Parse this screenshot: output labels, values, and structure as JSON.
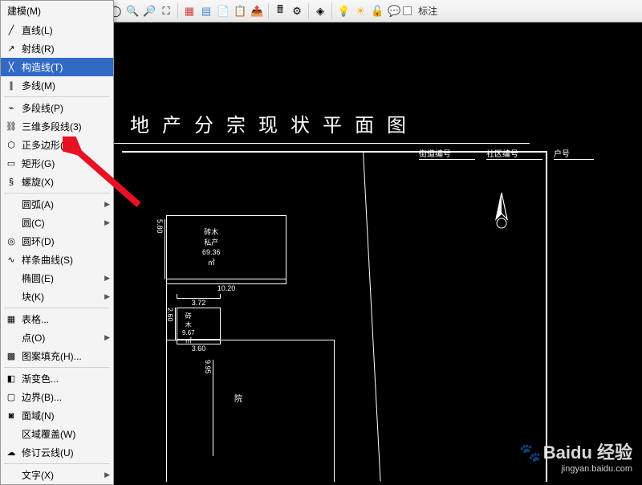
{
  "toolbar": {
    "annotation_label": "标注",
    "icons": [
      "pencil-icon",
      "brush-icon",
      "undo-icon",
      "redo-icon",
      "sep",
      "select-icon",
      "lasso-icon",
      "zoom-in-icon",
      "zoom-out-icon",
      "zoom-extent-icon",
      "sep",
      "grid-icon",
      "table-icon",
      "sheet-icon",
      "props-icon",
      "export-icon",
      "calc-icon",
      "settings-icon",
      "sep",
      "layers-icon",
      "sep",
      "bulb-icon",
      "sun-icon",
      "lock-icon",
      "chat-icon"
    ]
  },
  "menu": {
    "title": "建模(M)",
    "groups": [
      [
        {
          "icon": "line-icon",
          "label": "直线(L)",
          "arrow": false
        },
        {
          "icon": "ray-icon",
          "label": "射线(R)",
          "arrow": false
        },
        {
          "icon": "xline-icon",
          "label": "构造线(T)",
          "arrow": false,
          "selected": true
        },
        {
          "icon": "mline-icon",
          "label": "多线(M)",
          "arrow": false
        }
      ],
      [
        {
          "icon": "pline-icon",
          "label": "多段线(P)",
          "arrow": false
        },
        {
          "icon": "3dpoly-icon",
          "label": "三维多段线(3)",
          "arrow": false
        },
        {
          "icon": "polygon-icon",
          "label": "正多边形(Y)",
          "arrow": false
        },
        {
          "icon": "rect-icon",
          "label": "矩形(G)",
          "arrow": false
        },
        {
          "icon": "helix-icon",
          "label": "螺旋(X)",
          "arrow": false
        }
      ],
      [
        {
          "icon": "",
          "label": "圆弧(A)",
          "arrow": true
        },
        {
          "icon": "",
          "label": "圆(C)",
          "arrow": true
        },
        {
          "icon": "donut-icon",
          "label": "圆环(D)",
          "arrow": false
        },
        {
          "icon": "spline-icon",
          "label": "样条曲线(S)",
          "arrow": false
        },
        {
          "icon": "",
          "label": "椭圆(E)",
          "arrow": true
        },
        {
          "icon": "",
          "label": "块(K)",
          "arrow": true
        }
      ],
      [
        {
          "icon": "table-icon",
          "label": "表格...",
          "arrow": false
        },
        {
          "icon": "",
          "label": "点(O)",
          "arrow": true
        },
        {
          "icon": "hatch-icon",
          "label": "图案填充(H)...",
          "arrow": false
        }
      ],
      [
        {
          "icon": "gradient-icon",
          "label": "渐变色...",
          "arrow": false
        },
        {
          "icon": "boundary-icon",
          "label": "边界(B)...",
          "arrow": false
        },
        {
          "icon": "region-icon",
          "label": "面域(N)",
          "arrow": false
        },
        {
          "icon": "",
          "label": "区域覆盖(W)",
          "arrow": false
        },
        {
          "icon": "revcloud-icon",
          "label": "修订云线(U)",
          "arrow": false
        }
      ],
      [
        {
          "icon": "",
          "label": "文字(X)",
          "arrow": true
        }
      ]
    ]
  },
  "drawing": {
    "title": "地产分宗现状平面图",
    "headers": {
      "street": "街道编号",
      "community": "社区编号",
      "household": "户号"
    },
    "block1": {
      "l1": "砖木",
      "l2": "私产",
      "l3": "69.36㎡"
    },
    "block2": {
      "l1": "砖木",
      "l2": "9.67㎡"
    },
    "block3": {
      "label": "院"
    },
    "dims": {
      "w1": "10.20",
      "h1": "5.80",
      "w2": "3.72",
      "h2": "2.60",
      "w3": "3.60",
      "h3": "9.95"
    }
  },
  "watermark": {
    "main": "Baidu 经验",
    "sub": "jingyan.baidu.com"
  }
}
